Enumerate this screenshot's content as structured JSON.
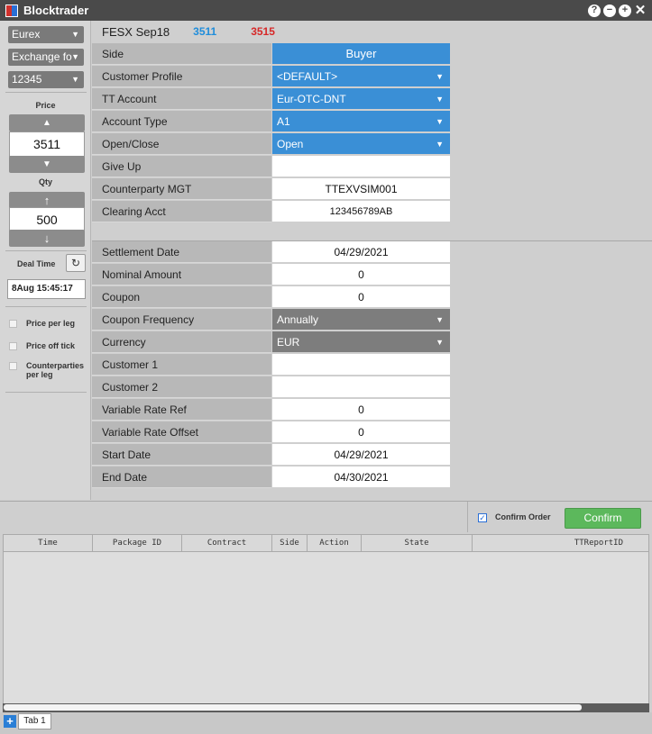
{
  "app": {
    "title": "Blocktrader"
  },
  "window_controls": {
    "help": "?",
    "minimize": "−",
    "maximize": "+",
    "close": "✕"
  },
  "sidebar": {
    "exchange": "Eurex",
    "order_type": "Exchange fo",
    "account": "12345",
    "price_label": "Price",
    "price_value": "3511",
    "qty_label": "Qty",
    "qty_value": "500",
    "deal_time_label": "Deal Time",
    "deal_time_value": "8Aug 15:45:17",
    "checkboxes": [
      {
        "label": "Price per leg"
      },
      {
        "label": "Price off tick"
      },
      {
        "label": "Counterparties per leg"
      }
    ]
  },
  "header": {
    "contract": "FESX Sep18",
    "bid": "3511",
    "ask": "3515"
  },
  "form": {
    "side": {
      "label": "Side",
      "value": "Buyer"
    },
    "customer_profile": {
      "label": "Customer Profile",
      "value": "<DEFAULT>"
    },
    "tt_account": {
      "label": "TT Account",
      "value": "Eur-OTC-DNT"
    },
    "account_type": {
      "label": "Account Type",
      "value": "A1"
    },
    "open_close": {
      "label": "Open/Close",
      "value": "Open"
    },
    "give_up": {
      "label": "Give Up",
      "value": ""
    },
    "counterparty_mgt": {
      "label": "Counterparty MGT",
      "value": "TTEXVSIM001"
    },
    "clearing_acct": {
      "label": "Clearing Acct",
      "value": "123456789AB"
    },
    "settlement_date": {
      "label": "Settlement Date",
      "value": "04/29/2021"
    },
    "nominal_amount": {
      "label": "Nominal Amount",
      "value": "0"
    },
    "coupon": {
      "label": "Coupon",
      "value": "0"
    },
    "coupon_frequency": {
      "label": "Coupon Frequency",
      "value": "Annually"
    },
    "currency": {
      "label": "Currency",
      "value": "EUR"
    },
    "customer_1": {
      "label": "Customer 1",
      "value": ""
    },
    "customer_2": {
      "label": "Customer 2",
      "value": ""
    },
    "variable_rate_ref": {
      "label": "Variable Rate Ref",
      "value": "0"
    },
    "variable_rate_offset": {
      "label": "Variable Rate Offset",
      "value": "0"
    },
    "start_date": {
      "label": "Start Date",
      "value": "04/29/2021"
    },
    "end_date": {
      "label": "End Date",
      "value": "04/30/2021"
    }
  },
  "actions": {
    "confirm_order_label": "Confirm Order",
    "confirm_button": "Confirm"
  },
  "grid": {
    "columns": [
      "Time",
      "Package ID",
      "Contract",
      "Side",
      "Action",
      "State",
      "TTReportID"
    ]
  },
  "tabs": [
    {
      "label": "Tab 1"
    }
  ],
  "colors": {
    "accent": "#3a8fd6",
    "bid": "#1f8ddb",
    "ask": "#d62828",
    "confirm": "#5cb85c"
  }
}
